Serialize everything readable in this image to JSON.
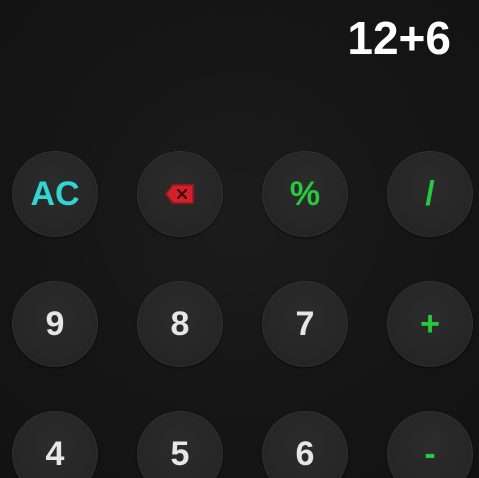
{
  "display": {
    "expression": "12+6"
  },
  "keys": {
    "row1": [
      {
        "label": "AC",
        "type": "clear"
      },
      {
        "label": "",
        "type": "backspace",
        "icon": "backspace-icon"
      },
      {
        "label": "%",
        "type": "operator"
      },
      {
        "label": "/",
        "type": "operator"
      }
    ],
    "row2": [
      {
        "label": "9",
        "type": "digit"
      },
      {
        "label": "8",
        "type": "digit"
      },
      {
        "label": "7",
        "type": "digit"
      },
      {
        "label": "+",
        "type": "operator"
      }
    ],
    "row3": [
      {
        "label": "4",
        "type": "digit"
      },
      {
        "label": "5",
        "type": "digit"
      },
      {
        "label": "6",
        "type": "digit"
      },
      {
        "label": "-",
        "type": "operator"
      }
    ]
  },
  "colors": {
    "clear": "#2fd6d2",
    "operator": "#28c840",
    "digit": "#e6e6e6",
    "backspace": "#d4202a",
    "background": "#151515",
    "key_background": "#262626"
  }
}
